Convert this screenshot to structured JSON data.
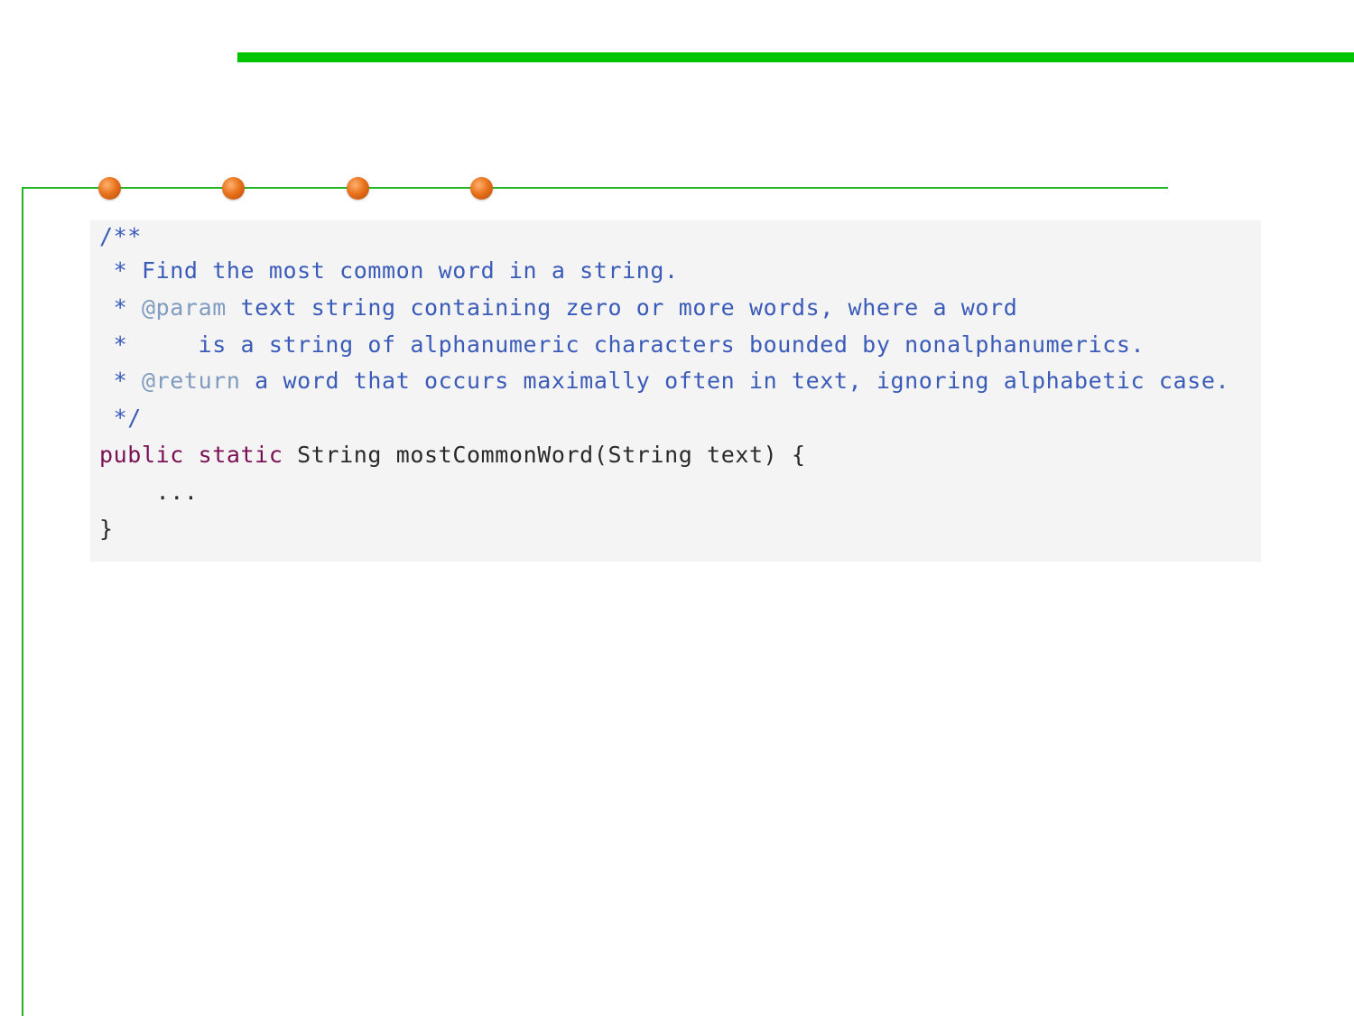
{
  "colors": {
    "accent_green": "#00c400",
    "frame_green": "#22b722",
    "bullet_orange": "#e8731c",
    "code_background": "#f4f4f4",
    "comment_blue": "#3a5bb8",
    "doc_tag_gray_blue": "#7f9bbf",
    "keyword_purple": "#7a1055",
    "plain_text": "#2a2a2a"
  },
  "decoration": {
    "bullets": [
      "orange-bullet",
      "orange-bullet",
      "orange-bullet",
      "orange-bullet"
    ]
  },
  "code": {
    "language": "java",
    "lines": [
      [
        {
          "text": "/**",
          "kind": "comment"
        }
      ],
      [
        {
          "text": " * Find the most common word in a string.",
          "kind": "comment"
        }
      ],
      [
        {
          "text": " * ",
          "kind": "comment"
        },
        {
          "text": "@param",
          "kind": "doctag"
        },
        {
          "text": " text string containing zero or more words, where a word",
          "kind": "comment"
        }
      ],
      [
        {
          "text": " *     is a string of alphanumeric characters bounded by nonalphanumerics.",
          "kind": "comment"
        }
      ],
      [
        {
          "text": " * ",
          "kind": "comment"
        },
        {
          "text": "@return",
          "kind": "doctag"
        },
        {
          "text": " a word that occurs maximally often in text, ignoring alphabetic case.",
          "kind": "comment"
        }
      ],
      [
        {
          "text": " */",
          "kind": "comment"
        }
      ],
      [
        {
          "text": "public",
          "kind": "keyword"
        },
        {
          "text": " ",
          "kind": "plain"
        },
        {
          "text": "static",
          "kind": "keyword"
        },
        {
          "text": " String mostCommonWord(String text) {",
          "kind": "plain"
        }
      ],
      [
        {
          "text": "    ...",
          "kind": "plain"
        }
      ],
      [
        {
          "text": "}",
          "kind": "plain"
        }
      ]
    ]
  }
}
